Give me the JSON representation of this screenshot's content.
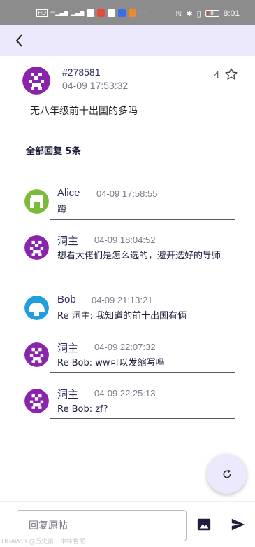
{
  "status_bar": {
    "time": "8:01",
    "battery": "8",
    "left_icons": [
      "HD",
      "4G",
      "signal",
      "signal",
      "X",
      "app",
      "app",
      "app",
      "app",
      "more"
    ]
  },
  "post": {
    "id": "#278581",
    "time": "04-09 17:53:32",
    "likes": "4",
    "body": "无八年级前十出国的多吗"
  },
  "replies_header": "全部回复 5条",
  "replies": [
    {
      "name": "Alice",
      "time": "04-09 17:58:55",
      "text": "蹲",
      "avatar_color": "#7cbb38"
    },
    {
      "name": "洞主",
      "time": "04-09 18:04:52",
      "text": "想看大佬们是怎么选的，避开选好的导师",
      "avatar_color": "#8a24aa"
    },
    {
      "name": "Bob",
      "time": "04-09 21:13:21",
      "text": "Re 洞主: 我知道的前十出国有俩",
      "avatar_color": "#1f9fde"
    },
    {
      "name": "洞主",
      "time": "04-09 22:07:32",
      "text": "Re Bob: ww可以发缩写吗",
      "avatar_color": "#8a24aa"
    },
    {
      "name": "洞主",
      "time": "04-09 22:25:13",
      "text": "Re Bob: zf?",
      "avatar_color": "#8a24aa"
    }
  ],
  "input": {
    "placeholder": "回复原帖"
  },
  "watermark": "HUAWEI @历史第一中锋鲁尼",
  "colors": {
    "accent": "#ebe9fb",
    "post_avatar": "#8a24aa"
  },
  "icons": {
    "back": "back-arrow-icon",
    "star": "star-outline-icon",
    "refresh": "refresh-icon",
    "image": "image-icon",
    "send": "send-icon"
  }
}
